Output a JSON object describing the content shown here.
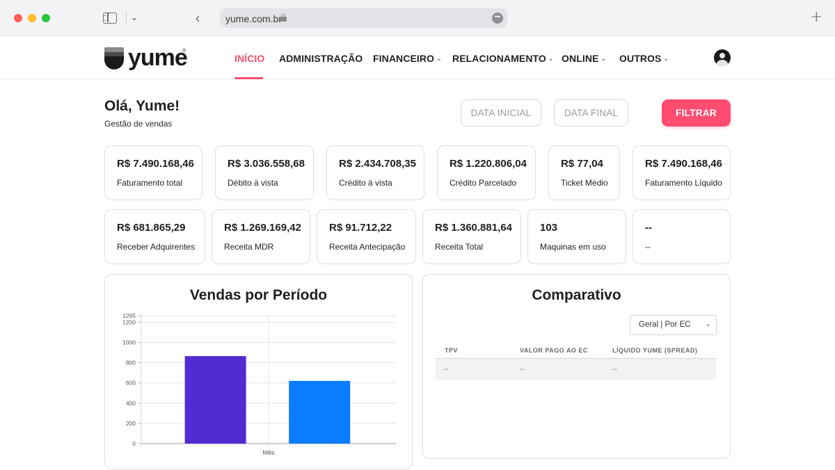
{
  "browser": {
    "url": "yume.com.br"
  },
  "brand": {
    "name": "yume",
    "accent_color": "#ff4d72"
  },
  "nav": {
    "items": [
      {
        "label": "INÍCIO",
        "active": true,
        "dropdown": false
      },
      {
        "label": "ADMINISTRAÇÃO",
        "active": false,
        "dropdown": false
      },
      {
        "label": "FINANCEIRO",
        "active": false,
        "dropdown": true
      },
      {
        "label": "RELACIONAMENTO",
        "active": false,
        "dropdown": true
      },
      {
        "label": "ONLINE",
        "active": false,
        "dropdown": true
      },
      {
        "label": "OUTROS",
        "active": false,
        "dropdown": true
      }
    ]
  },
  "header": {
    "greeting": "Olá, Yume!",
    "subtitle": "Gestão de vendas",
    "date_initial": "DATA INICIAL",
    "date_final": "DATA FINAL",
    "filter": "FILTRAR"
  },
  "kpis_row1": [
    {
      "value": "R$ 7.490.168,46",
      "label": "Faturamento total"
    },
    {
      "value": "R$ 3.036.558,68",
      "label": "Débito à vista"
    },
    {
      "value": "R$ 2.434.708,35",
      "label": "Crédito à vista"
    },
    {
      "value": "R$ 1.220.806,04",
      "label": "Crédito Parcelado"
    },
    {
      "value": "R$ 77,04",
      "label": "Ticket Médio"
    },
    {
      "value": "R$ 7.490.168,46",
      "label": "Faturamento Líquido"
    }
  ],
  "kpis_row2": [
    {
      "value": "R$ 681.865,29",
      "label": "Receber Adquirentes"
    },
    {
      "value": "R$ 1.269.169,42",
      "label": "Receita MDR"
    },
    {
      "value": "R$ 91.712,22",
      "label": "Receita Antecipação"
    },
    {
      "value": "R$ 1.360.881,64",
      "label": "Receita Total"
    },
    {
      "value": "103",
      "label": "Maquinas em uso"
    },
    {
      "value": "--",
      "label": "--"
    }
  ],
  "sales_chart": {
    "title": "Vendas por Período"
  },
  "chart_data": {
    "type": "bar",
    "title": "Vendas por Período",
    "xlabel": "Mês",
    "ylabel": "",
    "categories": [
      "",
      ""
    ],
    "values": [
      865,
      620
    ],
    "colors": [
      "#532bd3",
      "#0a7cff"
    ],
    "y_ticks": [
      0,
      200,
      400,
      600,
      800,
      1000,
      1200,
      1265
    ],
    "ylim": [
      0,
      1265
    ],
    "grid": true
  },
  "comparativo": {
    "title": "Comparativo",
    "select_value": "Geral | Por EC",
    "columns": [
      "TPV",
      "VALOR PAGO AO EC",
      "LÍQUIDO YUME (SPREAD)"
    ],
    "rows": [
      [
        "--",
        "--",
        "--"
      ]
    ]
  }
}
